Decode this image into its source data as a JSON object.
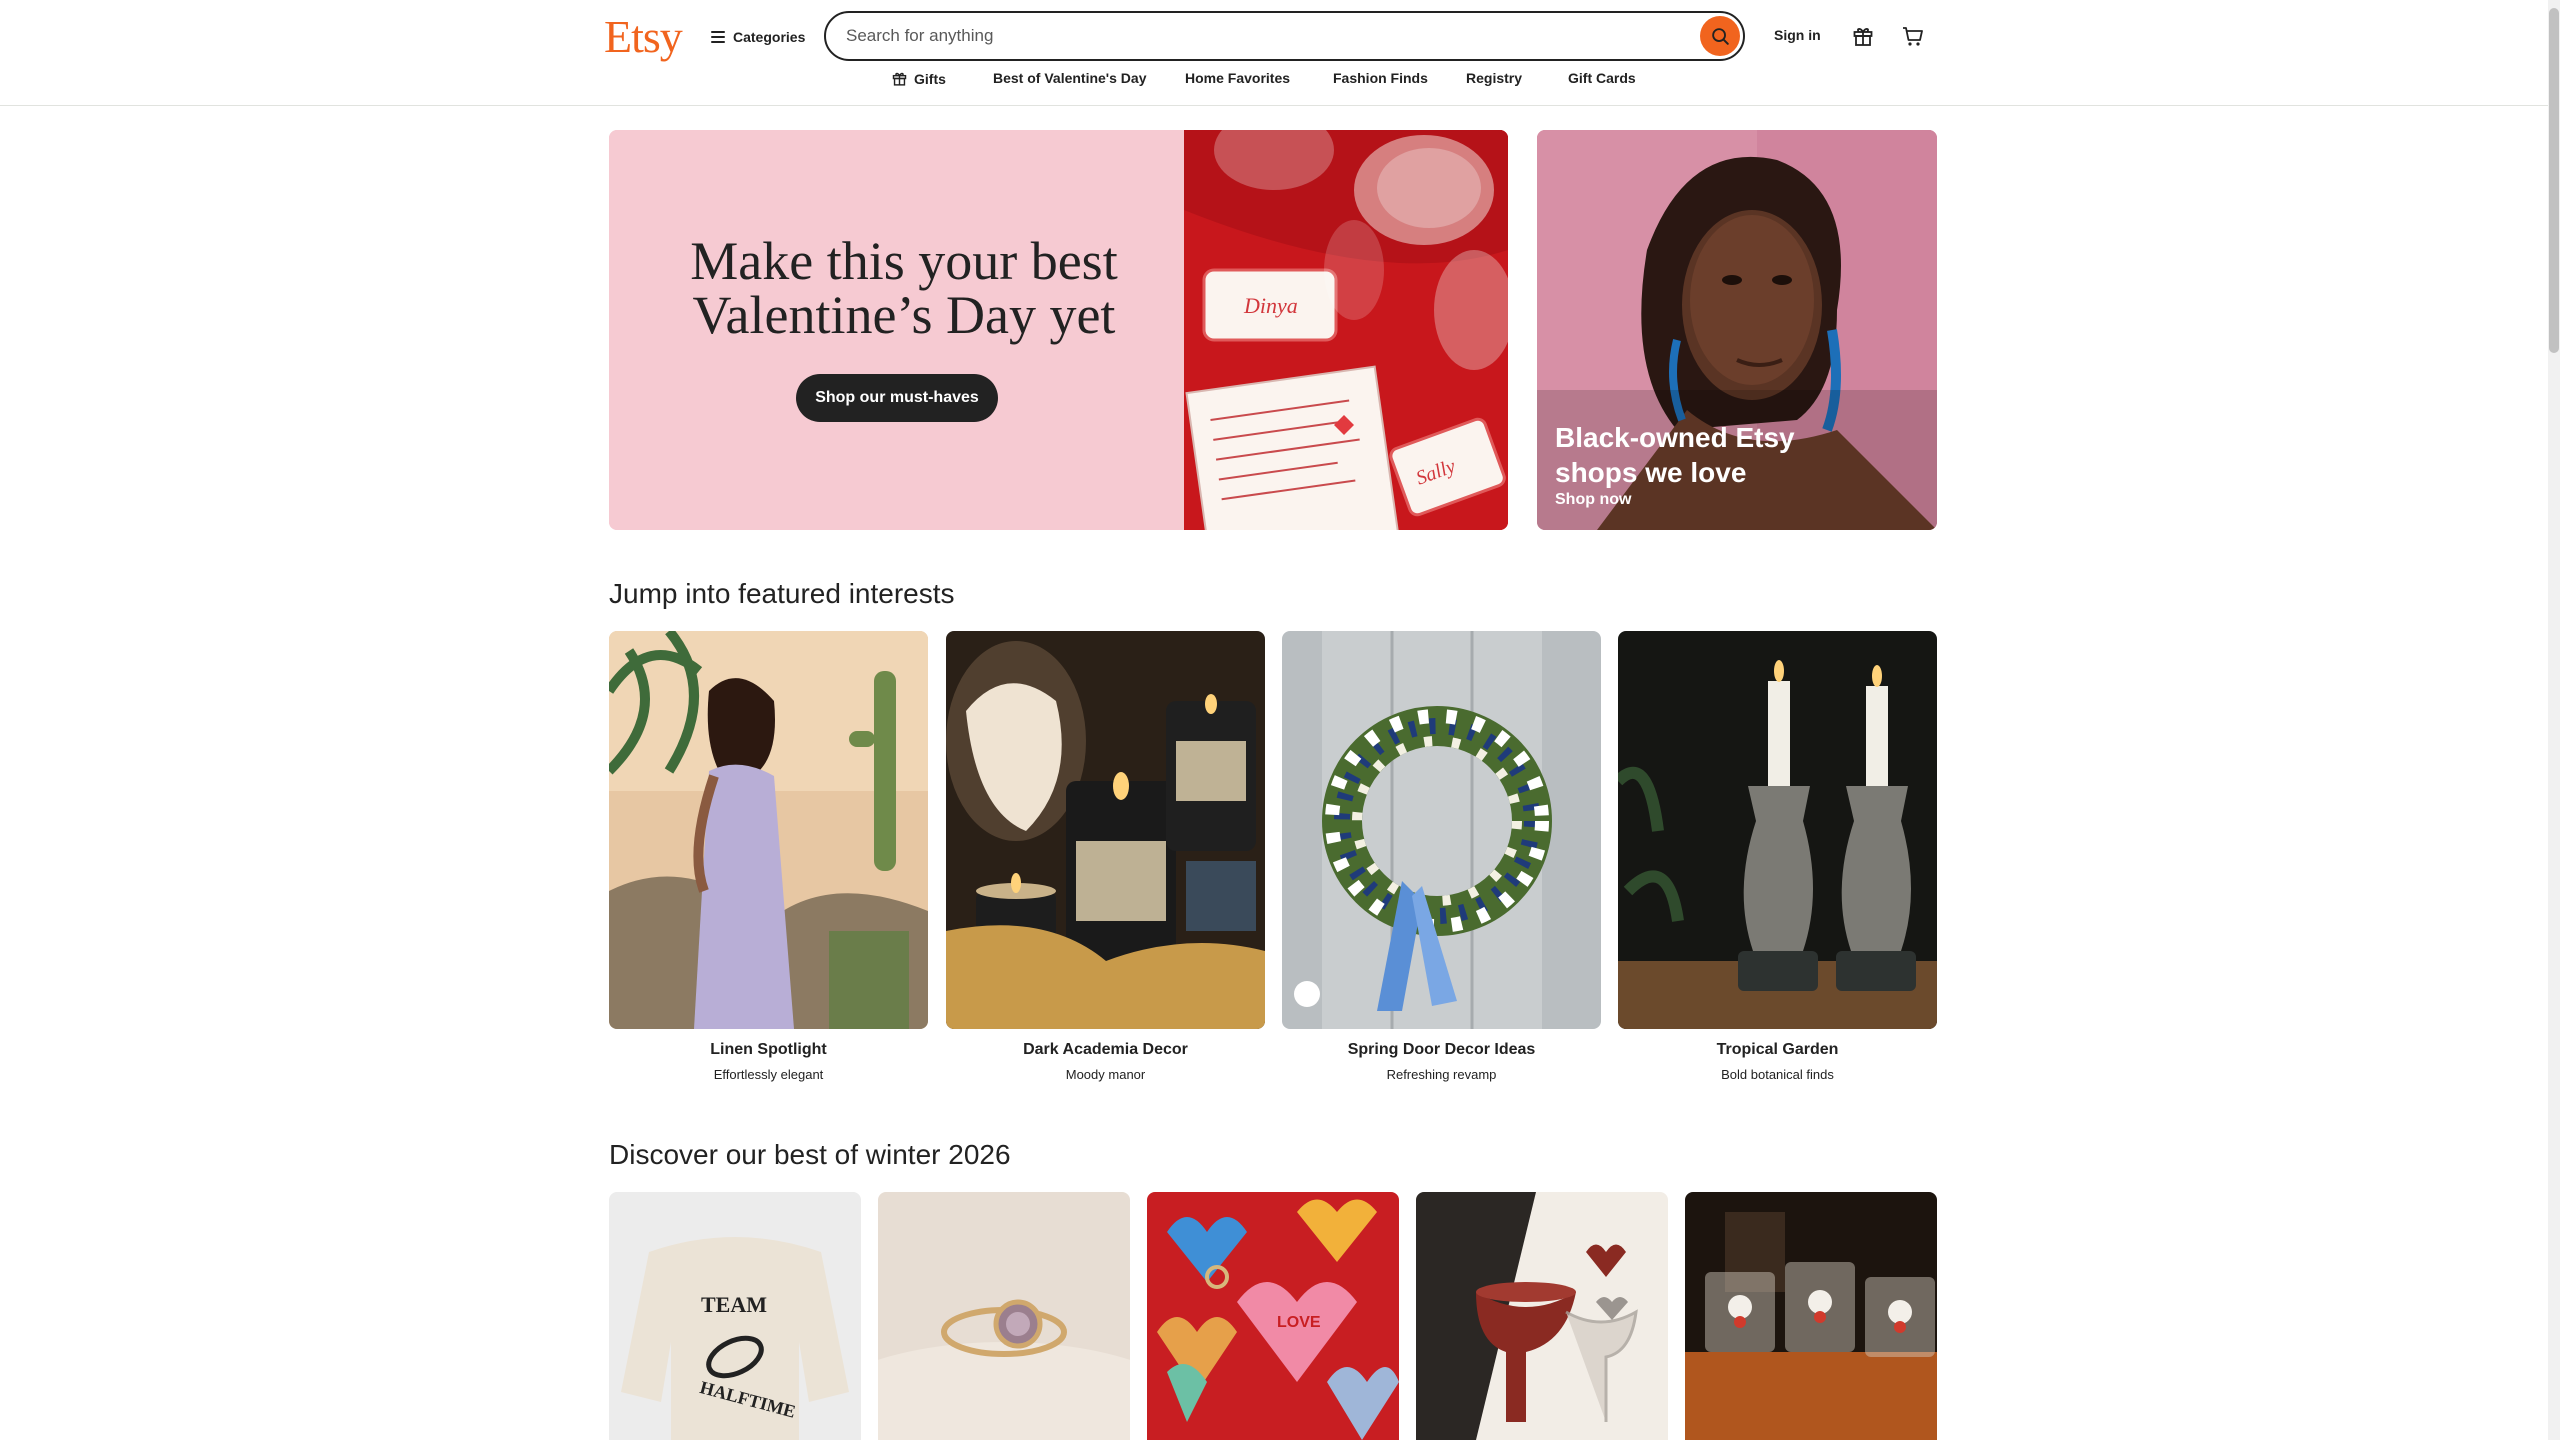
{
  "header": {
    "logo": "Etsy",
    "categories_label": "Categories",
    "search_placeholder": "Search for anything",
    "signin_label": "Sign in"
  },
  "subnav": {
    "items": [
      "Gifts",
      "Best of Valentine's Day",
      "Home Favorites",
      "Fashion Finds",
      "Registry",
      "Gift Cards"
    ]
  },
  "hero": {
    "title_line1": "Make this your best",
    "title_line2": "Valentine’s Day yet",
    "button_label": "Shop our must-haves",
    "side_title": "Black-owned Etsy shops we love",
    "side_link": "Shop now"
  },
  "interests": {
    "title": "Jump into featured interests",
    "items": [
      {
        "name": "Linen Spotlight",
        "sub": "Effortlessly elegant"
      },
      {
        "name": "Dark Academia Decor",
        "sub": "Moody manor"
      },
      {
        "name": "Spring Door Decor Ideas",
        "sub": "Refreshing revamp"
      },
      {
        "name": "Tropical Garden",
        "sub": "Bold botanical finds"
      }
    ]
  },
  "winter": {
    "title": "Discover our best of winter 2026"
  },
  "colors": {
    "brand": "#f1641e",
    "text": "#222222",
    "hero_pink": "#f6cad2"
  }
}
